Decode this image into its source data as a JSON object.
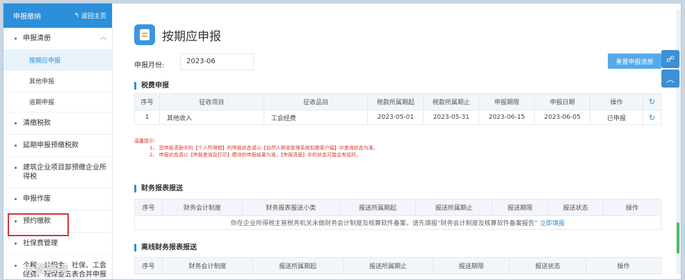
{
  "sidebar": {
    "header_title": "申报缴纳",
    "back_label": "返回主页",
    "items": [
      {
        "label": "申报清册",
        "expanded": true
      },
      {
        "sub": "按期应申报"
      },
      {
        "sub": "其他申报"
      },
      {
        "sub": "逾期申报"
      },
      {
        "label": "清缴税款"
      },
      {
        "label": "延期申报预缴税款"
      },
      {
        "label": "建筑企业项目部预缴企业所得税"
      },
      {
        "label": "申报作废"
      },
      {
        "label": "预约缴款"
      },
      {
        "label": "社保费管理"
      },
      {
        "label": "个税、公积金、社保、工会经费、残保金五表合并申报"
      }
    ]
  },
  "main": {
    "title": "按期应申报",
    "month_label": "申报月份:",
    "month_value": "2023-06",
    "reset_button": "重置申报清册"
  },
  "tax_section": {
    "title": "税费申报",
    "columns": [
      "序号",
      "征收项目",
      "征收品目",
      "税款所属期起",
      "税款所属期止",
      "申报期限",
      "申报日期",
      "操作"
    ],
    "rows": [
      [
        "1",
        "其他收入",
        "工会经费",
        "2023-05-01",
        "2023-05-31",
        "2023-06-15",
        "2023-06-05",
        "已申报"
      ]
    ]
  },
  "warning": {
    "title": "温馨提示:",
    "line1": "1、 您申报清册中的【个人所得税】的申报状态请以【自然人税收管理系统扣缴客户端】中查询状态为准。",
    "line2": "2、 申报状态请以【申报查询及打印】模块的申报结果为准，【申报清册】中的状态可能会有延时。"
  },
  "fin_section": {
    "title": "财务报表报送",
    "columns": [
      "序号",
      "财务会计制度",
      "财务报表报送小类",
      "报送所属期起",
      "报送所属期止",
      "报送期限",
      "报送状态",
      "操作"
    ],
    "tip": "你在企业所得税主管税务机关未做财务会计制度及核算软件备案，请先填报“财务会计制度及核算软件备案报告”",
    "tip_link": "立即填报"
  },
  "offline_section": {
    "title": "离线财务报表报送",
    "columns": [
      "序号",
      "财务会计制度",
      "报送所属期起",
      "报送所属期止",
      "报送期限",
      "报送状态",
      "操作"
    ]
  },
  "watermark": "大数跨境",
  "colors": {
    "accent": "#2c8fd9",
    "warning": "#d93a2f",
    "highlight": "#d63333"
  }
}
